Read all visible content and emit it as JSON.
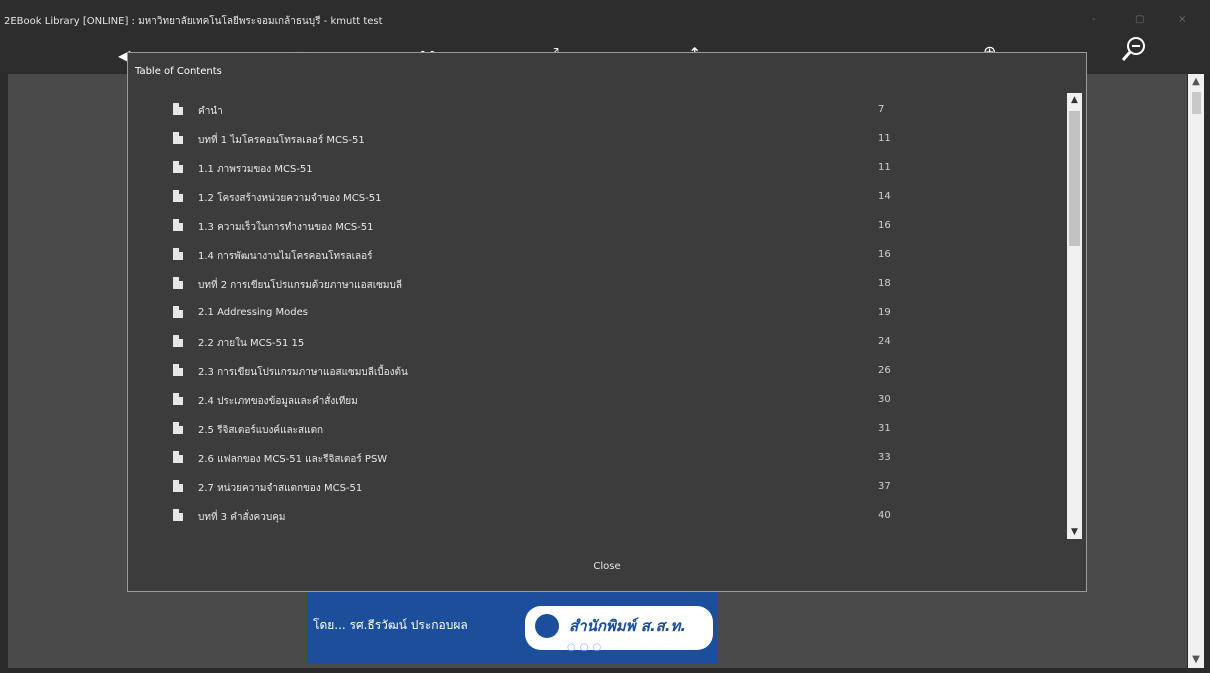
{
  "window": {
    "title": "2EBook Library [ONLINE] : มหาวิทยาลัยเทคโนโลยีพระจอมเกล้าธนบุรี  - kmutt test",
    "controls": [
      "-",
      "▢",
      "×"
    ]
  },
  "toolbar": {
    "icons": [
      "back-arrow-icon",
      "contents-icon",
      "thumbnails-icon",
      "fullscreen-icon",
      "upload-icon",
      "export-icon",
      "zoom-in-icon",
      "zoom-out-icon"
    ]
  },
  "dialog": {
    "title": "Table of Contents",
    "close_label": "Close",
    "entries": [
      {
        "label": "คำนำ",
        "page": "7"
      },
      {
        "label": "บทที่ 1 ไมโครคอนโทรลเลอร์ MCS-51",
        "page": "11"
      },
      {
        "label": "1.1  ภาพรวมของ MCS-51",
        "page": "11"
      },
      {
        "label": "1.2  โครงสร้างหน่วยความจำของ MCS-51",
        "page": "14"
      },
      {
        "label": "1.3  ความเร็วในการทำงานของ MCS-51",
        "page": "16"
      },
      {
        "label": "1.4  การพัฒนางานไมโครคอนโทรลเลอร์",
        "page": "16"
      },
      {
        "label": "บทที่ 2 การเขียนโปรแกรมด้วยภาษาแอสเซมบลี",
        "page": "18"
      },
      {
        "label": "2.1  Addressing Modes",
        "page": "19"
      },
      {
        "label": "2.2  ภายใน MCS-51 15",
        "page": "24"
      },
      {
        "label": "2.3  การเขียนโปรแกรมภาษาแอสแซมบลีเบื้องต้น",
        "page": "26"
      },
      {
        "label": "2.4  ประเภทของข้อมูลและคำสั่งเทียม",
        "page": "30"
      },
      {
        "label": "2.5  รีจิสเตอร์แบงค์และสแตก",
        "page": "31"
      },
      {
        "label": "2.6  แฟลกของ MCS-51 และรีจิสเตอร์ PSW",
        "page": "33"
      },
      {
        "label": "2.7  หน่วยความจำสแตกของ MCS-51",
        "page": "37"
      },
      {
        "label": "บทที่ 3 คำสั่งควบคุม",
        "page": "40"
      }
    ]
  },
  "book_cover": {
    "author": "โดย... รศ.ธีรวัฒน์ ประกอบผล",
    "publisher": "สำนักพิมพ์ ส.ส.ท."
  }
}
